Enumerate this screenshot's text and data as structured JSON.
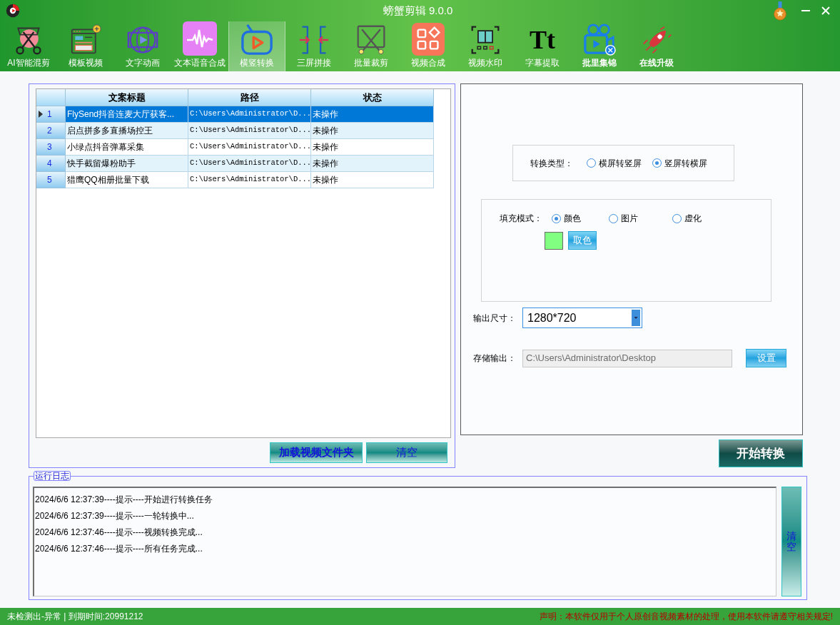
{
  "window": {
    "title": "螃蟹剪辑 9.0.0"
  },
  "toolbar": [
    {
      "label": "AI智能混剪",
      "selected": false,
      "emphasized": false
    },
    {
      "label": "模板视频",
      "selected": false,
      "emphasized": false
    },
    {
      "label": "文字动画",
      "selected": false,
      "emphasized": false
    },
    {
      "label": "文本语音合成",
      "selected": false,
      "emphasized": false
    },
    {
      "label": "横竖转换",
      "selected": true,
      "emphasized": false
    },
    {
      "label": "三屏拼接",
      "selected": false,
      "emphasized": false
    },
    {
      "label": "批量裁剪",
      "selected": false,
      "emphasized": false
    },
    {
      "label": "视频合成",
      "selected": false,
      "emphasized": false
    },
    {
      "label": "视频水印",
      "selected": false,
      "emphasized": false
    },
    {
      "label": "字幕提取",
      "selected": false,
      "emphasized": false,
      "glyph": "Tt"
    },
    {
      "label": "批里集锦",
      "selected": false,
      "emphasized": true
    },
    {
      "label": "在线升级",
      "selected": false,
      "emphasized": true
    }
  ],
  "table": {
    "columns": [
      "文案标题",
      "路径",
      "状态"
    ],
    "rows": [
      {
        "number": "1",
        "title": "FlySend抖音连麦大厅获客...",
        "path": "C:\\Users\\Administrator\\D...",
        "status": "未操作",
        "selected": true
      },
      {
        "number": "2",
        "title": "启点拼多多直播场控王",
        "path": "C:\\Users\\Administrator\\D...",
        "status": "未操作",
        "selected": false
      },
      {
        "number": "3",
        "title": "小绿点抖音弹幕采集",
        "path": "C:\\Users\\Administrator\\D...",
        "status": "未操作",
        "selected": false
      },
      {
        "number": "4",
        "title": "快手截留爆粉助手",
        "path": "C:\\Users\\Administrator\\D...",
        "status": "未操作",
        "selected": false
      },
      {
        "number": "5",
        "title": "猎鹰QQ相册批量下载",
        "path": "C:\\Users\\Administrator\\D...",
        "status": "未操作",
        "selected": false
      }
    ]
  },
  "table_buttons": [
    "加载视频文件夹",
    "清空"
  ],
  "conversion": {
    "label": "转换类型：",
    "options": [
      {
        "label": "横屏转竖屏",
        "selected": false
      },
      {
        "label": "竖屏转横屏",
        "selected": true
      }
    ]
  },
  "fill": {
    "label": "填充模式：",
    "options": [
      {
        "label": "颜色",
        "selected": true
      },
      {
        "label": "图片",
        "selected": false
      },
      {
        "label": "虚化",
        "selected": false
      }
    ],
    "color": "#80ff80",
    "pick_button": "取色"
  },
  "output_size": {
    "label": "输出尺寸：",
    "value": "1280*720"
  },
  "output_path": {
    "label": "存储输出：",
    "value": "C:\\Users\\Administrator\\Desktop",
    "disabled": true,
    "button": "设置"
  },
  "start_button": "开始转换",
  "log": {
    "title": "运行日志",
    "lines": [
      "2024/6/6 12:37:39----提示----开始进行转换任务",
      "2024/6/6 12:37:39----提示----一轮转换中...",
      "2024/6/6 12:37:46----提示----视频转换完成...",
      "2024/6/6 12:37:46----提示----所有任务完成..."
    ],
    "clear_button": "清空"
  },
  "status_bar": {
    "left": "未检测出-异常 | 到期时间:20991212",
    "right": "声明：本软件仅用于个人原创音视频素材的处理，使用本软件请遵守相关规定!"
  }
}
